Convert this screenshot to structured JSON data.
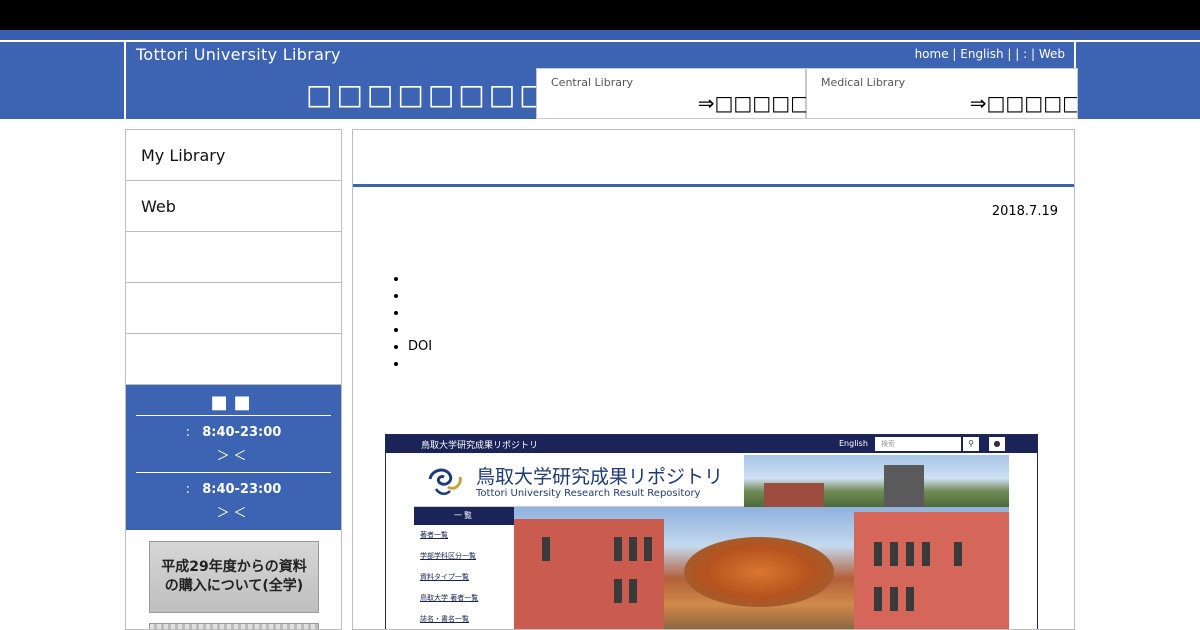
{
  "header": {
    "site_title": "Tottori University Library",
    "top_links": "home | English |      | :       | Web",
    "big_title": "□□□□□□□□□",
    "central": {
      "name": "Central Library",
      "status": "⇒□□□□□"
    },
    "medical": {
      "name": "Medical Library",
      "status": "⇒□□□□□"
    }
  },
  "sidebar": {
    "items": [
      {
        "label": "My Library"
      },
      {
        "label": "Web"
      },
      {
        "label": ""
      },
      {
        "label": ""
      },
      {
        "label": ""
      }
    ],
    "hours": {
      "title": "■■",
      "rows": [
        {
          "prefix": ":",
          "time": "8:40-23:00",
          "nav": "＞＜"
        },
        {
          "prefix": ":",
          "time": "8:40-23:00",
          "nav": "＞＜"
        }
      ]
    },
    "banner1": "平成29年度からの資料\nの購入について(全学)"
  },
  "main": {
    "date": "2018.7.19",
    "bullets": [
      "",
      "",
      "",
      "",
      "DOI",
      ""
    ],
    "embedded": {
      "bar_title": "鳥取大学研究成果リポジトリ",
      "english": "English",
      "search_placeholder": "検索",
      "search_icon": "magnifier-icon",
      "user_icon": "user-icon",
      "logo_jp": "鳥取大学研究成果リポジトリ",
      "logo_en": "Tottori University Research Result Repository",
      "menu_head": "一覧",
      "menu_items": [
        "著者一覧",
        "学部学科区分一覧",
        "資料タイプ一覧",
        "鳥取大学 著者一覧",
        "誌名・書名一覧"
      ]
    }
  },
  "colors": {
    "brand_blue": "#3d63b3",
    "navy": "#1b2459"
  }
}
